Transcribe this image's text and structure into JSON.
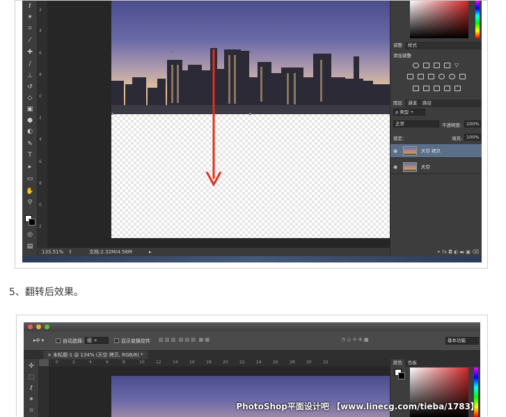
{
  "screenshot1": {
    "status_zoom": "133.51%",
    "status_doc": "文档:2.32M/4.56M",
    "ruler_numbers": [
      "2",
      "4",
      "6",
      "8",
      "0",
      "2",
      "4",
      "6",
      "8",
      "0",
      "2"
    ],
    "tools": [
      "lasso",
      "magic-wand",
      "crop",
      "eyedropper",
      "healing",
      "brush",
      "stamp",
      "history-brush",
      "eraser",
      "gradient",
      "blur",
      "dodge",
      "pen",
      "type",
      "path-select",
      "shape",
      "hand",
      "zoom"
    ],
    "adjust_tabs": [
      "调整",
      "样式"
    ],
    "adjust_title": "添加调整",
    "layers_tabs": [
      "图层",
      "通道",
      "路径"
    ],
    "layers_filter": "类型",
    "blend_mode": "正常",
    "opacity_label": "不透明度:",
    "opacity_value": "100%",
    "lock_label": "锁定:",
    "fill_label": "填充:",
    "fill_value": "100%",
    "layers": [
      {
        "name": "天空 拷贝",
        "selected": true
      },
      {
        "name": "天空",
        "selected": false
      }
    ],
    "arrow_color": "#e0321c"
  },
  "caption": "5、翻转后效果。",
  "screenshot2": {
    "auto_select_label": "自动选择:",
    "auto_select_value": "组",
    "show_transform_label": "显示变换控件",
    "workspace": "基本功能",
    "doc_tab": "未标题-1 @ 134% (天空 拷贝, RGB/8) *",
    "ruler_numbers": [
      "0",
      "2",
      "4",
      "6",
      "8",
      "10",
      "12",
      "14",
      "16",
      "18",
      "20",
      "22",
      "24",
      "26",
      "28",
      "30",
      "32"
    ],
    "panel_tabs": [
      "颜色",
      "色板"
    ],
    "watermark": "PhotoShop平面设计吧 【www.linecg.com/tieba/1783】"
  }
}
